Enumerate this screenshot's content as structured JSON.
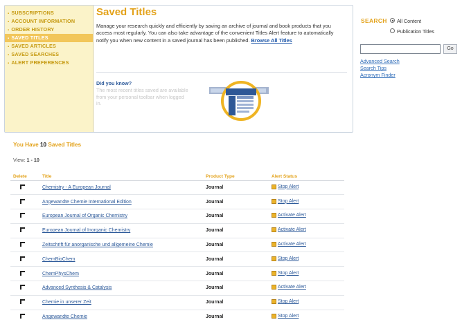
{
  "nav": {
    "items": [
      {
        "label": "SUBSCRIPTIONS",
        "active": false
      },
      {
        "label": "ACCOUNT INFORMATION",
        "active": false
      },
      {
        "label": "ORDER HISTORY",
        "active": false
      },
      {
        "label": "SAVED TITLES",
        "active": true
      },
      {
        "label": "SAVED ARTICLES",
        "active": false
      },
      {
        "label": "SAVED SEARCHES",
        "active": false
      },
      {
        "label": "ALERT PREFERENCES",
        "active": false
      }
    ]
  },
  "main": {
    "title": "Saved Titles",
    "intro": "Manage your research quickly and efficiently by saving an archive of journal and book products that you access most regularly. You can also take advantage of the convenient Titles Alert feature to automatically notify you when new content in a saved journal has been published.",
    "browse_link": "Browse All Titles"
  },
  "did_you_know": {
    "title": "Did you know?",
    "text": "The most recent titles saved are available from your personal toolbar when logged in."
  },
  "search": {
    "label": "SEARCH",
    "options": [
      "All Content",
      "Publication Titles"
    ],
    "selected": "All Content",
    "input_value": "",
    "go_label": "Go",
    "links": [
      "Advanced Search",
      "Search Tips",
      "Acronym Finder"
    ]
  },
  "summary": {
    "prefix": "You Have",
    "count": "10",
    "suffix": "Saved Titles",
    "view_label": "View:",
    "view_range": "1 - 10"
  },
  "table": {
    "headers": [
      "Delete",
      "Title",
      "Product Type",
      "Alert Status"
    ],
    "rows": [
      {
        "title": "Chemistry - A European Journal",
        "type": "Journal",
        "alert": "Stop Alert"
      },
      {
        "title": "Angewandte Chemie International Edition",
        "type": "Journal",
        "alert": "Stop Alert"
      },
      {
        "title": "European Journal of Organic Chemistry",
        "type": "Journal",
        "alert": "Activate Alert"
      },
      {
        "title": "European Journal of Inorganic Chemistry",
        "type": "Journal",
        "alert": "Activate Alert"
      },
      {
        "title": "Zeitschrift für anorganische und allgemeine Chemie",
        "type": "Journal",
        "alert": "Activate Alert"
      },
      {
        "title": "ChemBioChem",
        "type": "Journal",
        "alert": "Stop Alert"
      },
      {
        "title": "ChemPhysChem",
        "type": "Journal",
        "alert": "Stop Alert"
      },
      {
        "title": "Advanced Synthesis & Catalysis",
        "type": "Journal",
        "alert": "Activate Alert"
      },
      {
        "title": "Chemie in unserer Zeit",
        "type": "Journal",
        "alert": "Stop Alert"
      },
      {
        "title": "Angewandte Chemie",
        "type": "Journal",
        "alert": "Stop Alert"
      }
    ]
  },
  "colors": {
    "accent": "#e3a21a",
    "nav_bg": "#fbf3c9",
    "nav_active": "#f2c65a",
    "link": "#2d5a9a"
  }
}
